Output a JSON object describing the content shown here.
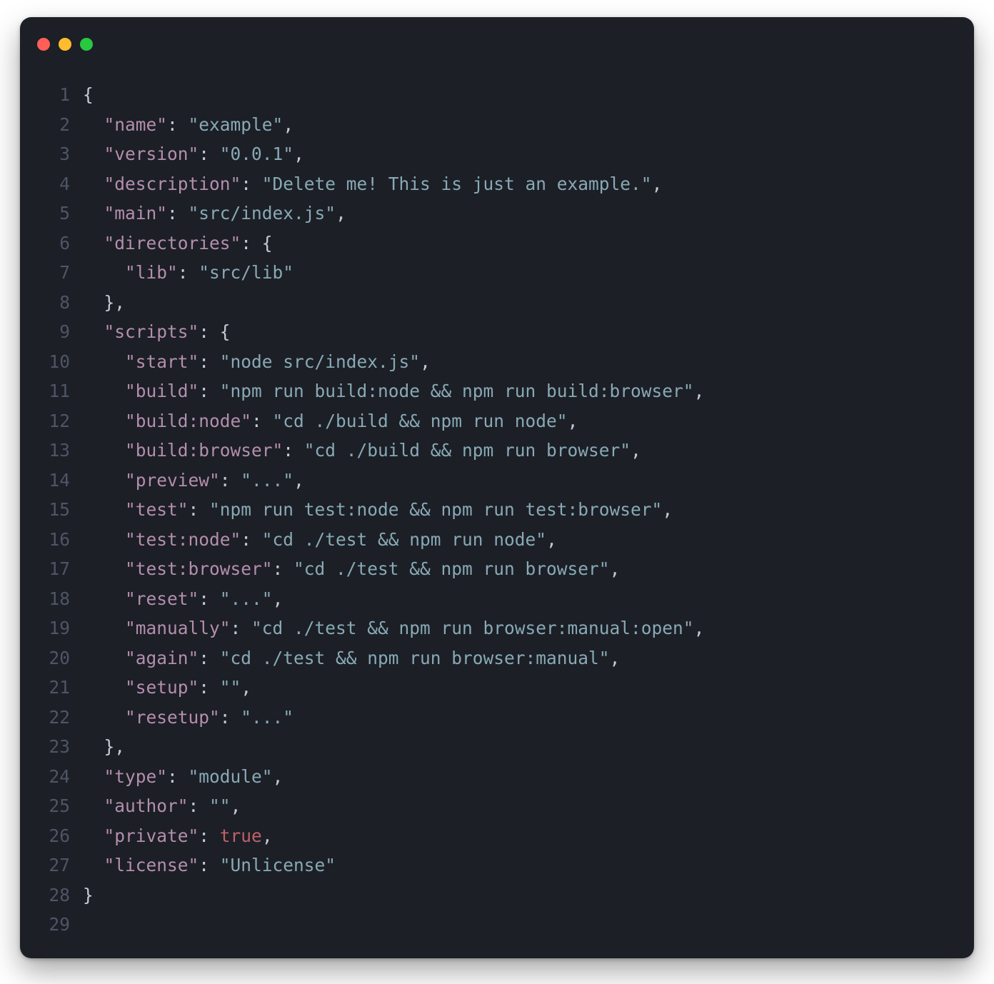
{
  "window": {
    "traffic_lights": [
      "close",
      "minimize",
      "zoom"
    ]
  },
  "editor": {
    "language": "json",
    "line_count": 29,
    "lines": [
      {
        "n": 1,
        "tokens": [
          {
            "t": "{",
            "c": "p"
          }
        ]
      },
      {
        "n": 2,
        "tokens": [
          {
            "t": "  ",
            "c": "p"
          },
          {
            "t": "\"name\"",
            "c": "key"
          },
          {
            "t": ": ",
            "c": "p"
          },
          {
            "t": "\"example\"",
            "c": "str"
          },
          {
            "t": ",",
            "c": "p"
          }
        ]
      },
      {
        "n": 3,
        "tokens": [
          {
            "t": "  ",
            "c": "p"
          },
          {
            "t": "\"version\"",
            "c": "key"
          },
          {
            "t": ": ",
            "c": "p"
          },
          {
            "t": "\"0.0.1\"",
            "c": "str"
          },
          {
            "t": ",",
            "c": "p"
          }
        ]
      },
      {
        "n": 4,
        "tokens": [
          {
            "t": "  ",
            "c": "p"
          },
          {
            "t": "\"description\"",
            "c": "key"
          },
          {
            "t": ": ",
            "c": "p"
          },
          {
            "t": "\"Delete me! This is just an example.\"",
            "c": "str"
          },
          {
            "t": ",",
            "c": "p"
          }
        ]
      },
      {
        "n": 5,
        "tokens": [
          {
            "t": "  ",
            "c": "p"
          },
          {
            "t": "\"main\"",
            "c": "key"
          },
          {
            "t": ": ",
            "c": "p"
          },
          {
            "t": "\"src/index.js\"",
            "c": "str"
          },
          {
            "t": ",",
            "c": "p"
          }
        ]
      },
      {
        "n": 6,
        "tokens": [
          {
            "t": "  ",
            "c": "p"
          },
          {
            "t": "\"directories\"",
            "c": "key"
          },
          {
            "t": ": {",
            "c": "p"
          }
        ]
      },
      {
        "n": 7,
        "tokens": [
          {
            "t": "    ",
            "c": "p"
          },
          {
            "t": "\"lib\"",
            "c": "key"
          },
          {
            "t": ": ",
            "c": "p"
          },
          {
            "t": "\"src/lib\"",
            "c": "str"
          }
        ]
      },
      {
        "n": 8,
        "tokens": [
          {
            "t": "  },",
            "c": "p"
          }
        ]
      },
      {
        "n": 9,
        "tokens": [
          {
            "t": "  ",
            "c": "p"
          },
          {
            "t": "\"scripts\"",
            "c": "key"
          },
          {
            "t": ": {",
            "c": "p"
          }
        ]
      },
      {
        "n": 10,
        "tokens": [
          {
            "t": "    ",
            "c": "p"
          },
          {
            "t": "\"start\"",
            "c": "key"
          },
          {
            "t": ": ",
            "c": "p"
          },
          {
            "t": "\"node src/index.js\"",
            "c": "str"
          },
          {
            "t": ",",
            "c": "p"
          }
        ]
      },
      {
        "n": 11,
        "tokens": [
          {
            "t": "    ",
            "c": "p"
          },
          {
            "t": "\"build\"",
            "c": "key"
          },
          {
            "t": ": ",
            "c": "p"
          },
          {
            "t": "\"npm run build:node && npm run build:browser\"",
            "c": "str"
          },
          {
            "t": ",",
            "c": "p"
          }
        ]
      },
      {
        "n": 12,
        "tokens": [
          {
            "t": "    ",
            "c": "p"
          },
          {
            "t": "\"build:node\"",
            "c": "key"
          },
          {
            "t": ": ",
            "c": "p"
          },
          {
            "t": "\"cd ./build && npm run node\"",
            "c": "str"
          },
          {
            "t": ",",
            "c": "p"
          }
        ]
      },
      {
        "n": 13,
        "tokens": [
          {
            "t": "    ",
            "c": "p"
          },
          {
            "t": "\"build:browser\"",
            "c": "key"
          },
          {
            "t": ": ",
            "c": "p"
          },
          {
            "t": "\"cd ./build && npm run browser\"",
            "c": "str"
          },
          {
            "t": ",",
            "c": "p"
          }
        ]
      },
      {
        "n": 14,
        "tokens": [
          {
            "t": "    ",
            "c": "p"
          },
          {
            "t": "\"preview\"",
            "c": "key"
          },
          {
            "t": ": ",
            "c": "p"
          },
          {
            "t": "\"...\"",
            "c": "str"
          },
          {
            "t": ",",
            "c": "p"
          }
        ]
      },
      {
        "n": 15,
        "tokens": [
          {
            "t": "    ",
            "c": "p"
          },
          {
            "t": "\"test\"",
            "c": "key"
          },
          {
            "t": ": ",
            "c": "p"
          },
          {
            "t": "\"npm run test:node && npm run test:browser\"",
            "c": "str"
          },
          {
            "t": ",",
            "c": "p"
          }
        ]
      },
      {
        "n": 16,
        "tokens": [
          {
            "t": "    ",
            "c": "p"
          },
          {
            "t": "\"test:node\"",
            "c": "key"
          },
          {
            "t": ": ",
            "c": "p"
          },
          {
            "t": "\"cd ./test && npm run node\"",
            "c": "str"
          },
          {
            "t": ",",
            "c": "p"
          }
        ]
      },
      {
        "n": 17,
        "tokens": [
          {
            "t": "    ",
            "c": "p"
          },
          {
            "t": "\"test:browser\"",
            "c": "key"
          },
          {
            "t": ": ",
            "c": "p"
          },
          {
            "t": "\"cd ./test && npm run browser\"",
            "c": "str"
          },
          {
            "t": ",",
            "c": "p"
          }
        ]
      },
      {
        "n": 18,
        "tokens": [
          {
            "t": "    ",
            "c": "p"
          },
          {
            "t": "\"reset\"",
            "c": "key"
          },
          {
            "t": ": ",
            "c": "p"
          },
          {
            "t": "\"...\"",
            "c": "str"
          },
          {
            "t": ",",
            "c": "p"
          }
        ]
      },
      {
        "n": 19,
        "tokens": [
          {
            "t": "    ",
            "c": "p"
          },
          {
            "t": "\"manually\"",
            "c": "key"
          },
          {
            "t": ": ",
            "c": "p"
          },
          {
            "t": "\"cd ./test && npm run browser:manual:open\"",
            "c": "str"
          },
          {
            "t": ",",
            "c": "p"
          }
        ]
      },
      {
        "n": 20,
        "tokens": [
          {
            "t": "    ",
            "c": "p"
          },
          {
            "t": "\"again\"",
            "c": "key"
          },
          {
            "t": ": ",
            "c": "p"
          },
          {
            "t": "\"cd ./test && npm run browser:manual\"",
            "c": "str"
          },
          {
            "t": ",",
            "c": "p"
          }
        ]
      },
      {
        "n": 21,
        "tokens": [
          {
            "t": "    ",
            "c": "p"
          },
          {
            "t": "\"setup\"",
            "c": "key"
          },
          {
            "t": ": ",
            "c": "p"
          },
          {
            "t": "\"\"",
            "c": "str"
          },
          {
            "t": ",",
            "c": "p"
          }
        ]
      },
      {
        "n": 22,
        "tokens": [
          {
            "t": "    ",
            "c": "p"
          },
          {
            "t": "\"resetup\"",
            "c": "key"
          },
          {
            "t": ": ",
            "c": "p"
          },
          {
            "t": "\"...\"",
            "c": "str"
          }
        ]
      },
      {
        "n": 23,
        "tokens": [
          {
            "t": "  },",
            "c": "p"
          }
        ]
      },
      {
        "n": 24,
        "tokens": [
          {
            "t": "  ",
            "c": "p"
          },
          {
            "t": "\"type\"",
            "c": "key"
          },
          {
            "t": ": ",
            "c": "p"
          },
          {
            "t": "\"module\"",
            "c": "str"
          },
          {
            "t": ",",
            "c": "p"
          }
        ]
      },
      {
        "n": 25,
        "tokens": [
          {
            "t": "  ",
            "c": "p"
          },
          {
            "t": "\"author\"",
            "c": "key"
          },
          {
            "t": ": ",
            "c": "p"
          },
          {
            "t": "\"\"",
            "c": "str"
          },
          {
            "t": ",",
            "c": "p"
          }
        ]
      },
      {
        "n": 26,
        "tokens": [
          {
            "t": "  ",
            "c": "p"
          },
          {
            "t": "\"private\"",
            "c": "key"
          },
          {
            "t": ": ",
            "c": "p"
          },
          {
            "t": "true",
            "c": "kw"
          },
          {
            "t": ",",
            "c": "p"
          }
        ]
      },
      {
        "n": 27,
        "tokens": [
          {
            "t": "  ",
            "c": "p"
          },
          {
            "t": "\"license\"",
            "c": "key"
          },
          {
            "t": ": ",
            "c": "p"
          },
          {
            "t": "\"Unlicense\"",
            "c": "str"
          }
        ]
      },
      {
        "n": 28,
        "tokens": [
          {
            "t": "}",
            "c": "p"
          }
        ]
      },
      {
        "n": 29,
        "tokens": [
          {
            "t": "",
            "c": "p"
          }
        ]
      }
    ]
  }
}
